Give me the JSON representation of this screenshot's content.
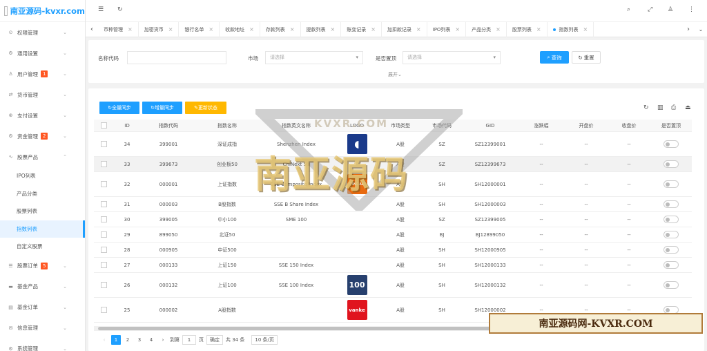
{
  "app": {
    "logo_text": "南亚源码-kvxr.com"
  },
  "sidebar": {
    "items": [
      {
        "label": "权限管理",
        "icon": "shield-icon",
        "glyph": "⊙"
      },
      {
        "label": "通用设置",
        "icon": "gear-icon",
        "glyph": "⚙"
      },
      {
        "label": "用户管理",
        "icon": "user-icon",
        "glyph": "♙",
        "badge": "1"
      },
      {
        "label": "货币管理",
        "icon": "currency-icon",
        "glyph": "⇄"
      },
      {
        "label": "支付设置",
        "icon": "payment-icon",
        "glyph": "⊕"
      },
      {
        "label": "资金管理",
        "icon": "fund-icon",
        "glyph": "⚙",
        "badge": "2"
      },
      {
        "label": "股票产品",
        "icon": "stock-icon",
        "glyph": "∿"
      }
    ],
    "sub_items": [
      "IPO列表",
      "产品分类",
      "股票列表",
      "指数列表",
      "自定义股票"
    ],
    "items_after": [
      {
        "label": "股票订单",
        "icon": "order-icon",
        "glyph": "☰",
        "badge": "5"
      },
      {
        "label": "基金产品",
        "icon": "fund-product-icon",
        "glyph": "▬"
      },
      {
        "label": "基金订单",
        "icon": "fund-order-icon",
        "glyph": "▤"
      },
      {
        "label": "信息管理",
        "icon": "message-icon",
        "glyph": "✉"
      },
      {
        "label": "系统管理",
        "icon": "system-icon",
        "glyph": "⚙"
      }
    ]
  },
  "tabs": [
    "币种管理",
    "加密货币",
    "银行名单",
    "收款地址",
    "存款列表",
    "提款列表",
    "账变记录",
    "加扣款记录",
    "IPO列表",
    "产品分类",
    "股票列表",
    "指数列表"
  ],
  "active_tab": "指数列表",
  "search": {
    "name_code_label": "名称代码",
    "market_label": "市场",
    "market_placeholder": "请选择",
    "top_label": "是否置顶",
    "top_placeholder": "请选择",
    "query_btn": "查询",
    "reset_btn": "重置",
    "expand": "展开"
  },
  "toolbar": {
    "full_sync": "全量同步",
    "inc_sync": "增量同步",
    "update_status": "更新状态",
    "colors": {
      "blue": "#1e9fff",
      "orange": "#ffb800"
    }
  },
  "table": {
    "headers": [
      "ID",
      "指数代码",
      "指数名称",
      "指数英文名称",
      "LOGO",
      "市场类型",
      "市场代码",
      "GID",
      "涨跌幅",
      "开盘价",
      "收盘价",
      "是否置顶"
    ],
    "rows": [
      {
        "id": "34",
        "code": "399001",
        "name": "深证成指",
        "en": "Shenzhen Index",
        "logo": "shield",
        "type": "A股",
        "mcode": "SZ",
        "gid": "SZ12399001",
        "chg": "--",
        "open": "--",
        "close": "--"
      },
      {
        "id": "33",
        "code": "399673",
        "name": "创业板50",
        "en": "ChiNext 50",
        "logo": "",
        "type": "A股",
        "mcode": "SZ",
        "gid": "SZ12399673",
        "chg": "--",
        "open": "--",
        "close": "--"
      },
      {
        "id": "32",
        "code": "000001",
        "name": "上证指数",
        "en": "SSE Composite Index",
        "logo": "orange",
        "type": "A股",
        "mcode": "SH",
        "gid": "SH12000001",
        "chg": "--",
        "open": "--",
        "close": "--"
      },
      {
        "id": "31",
        "code": "000003",
        "name": "B股指数",
        "en": "SSE B Share Index",
        "logo": "",
        "type": "A股",
        "mcode": "SH",
        "gid": "SH12000003",
        "chg": "--",
        "open": "--",
        "close": "--"
      },
      {
        "id": "30",
        "code": "399005",
        "name": "中小100",
        "en": "SME 100",
        "logo": "",
        "type": "A股",
        "mcode": "SZ",
        "gid": "SZ12399005",
        "chg": "--",
        "open": "--",
        "close": "--"
      },
      {
        "id": "29",
        "code": "899050",
        "name": "北证50",
        "en": "",
        "logo": "",
        "type": "A股",
        "mcode": "BJ",
        "gid": "BJ12899050",
        "chg": "--",
        "open": "--",
        "close": "--"
      },
      {
        "id": "28",
        "code": "000905",
        "name": "中证500",
        "en": "",
        "logo": "",
        "type": "A股",
        "mcode": "SH",
        "gid": "SH12000905",
        "chg": "--",
        "open": "--",
        "close": "--"
      },
      {
        "id": "27",
        "code": "000133",
        "name": "上证150",
        "en": "SSE 150 Index",
        "logo": "",
        "type": "A股",
        "mcode": "SH",
        "gid": "SH12000133",
        "chg": "--",
        "open": "--",
        "close": "--"
      },
      {
        "id": "26",
        "code": "000132",
        "name": "上证100",
        "en": "SSE 100 Index",
        "logo": "100",
        "type": "A股",
        "mcode": "SH",
        "gid": "SH12000132",
        "chg": "--",
        "open": "--",
        "close": "--"
      },
      {
        "id": "25",
        "code": "000002",
        "name": "A股指数",
        "en": "",
        "logo": "vanke",
        "type": "A股",
        "mcode": "SH",
        "gid": "SH12000002",
        "chg": "--",
        "open": "--",
        "close": "--"
      }
    ],
    "logo_texts": {
      "100": "100",
      "vanke": "vanke",
      "orange": "PINGAN"
    }
  },
  "pager": {
    "prev": "‹",
    "pages": [
      "1",
      "2",
      "3",
      "4"
    ],
    "next": "›",
    "goto": "到第",
    "page_value": "1",
    "page_unit": "页",
    "confirm": "确定",
    "total": "共 34 条",
    "size": "10 条/页"
  },
  "watermark": {
    "top": "KVXR.COM",
    "main": "南亚源码",
    "banner": "南亚源码网-KVXR.COM"
  }
}
